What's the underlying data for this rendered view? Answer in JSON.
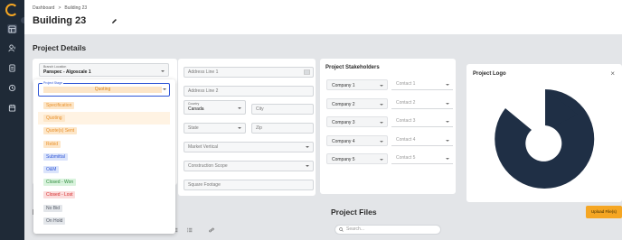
{
  "breadcrumb": {
    "items": [
      "Dashboard",
      "Building 23"
    ],
    "separator": ">"
  },
  "page": {
    "title": "Building 23"
  },
  "sections": {
    "project_details": "Project Details",
    "project_files": "Project Files",
    "lower_left_partial": "Pr"
  },
  "branch": {
    "label": "Branch Location",
    "value": "Panspec - Algoscale 1"
  },
  "stage": {
    "label": "Project Stage",
    "value": "Quoting",
    "options": [
      {
        "label": "Specification",
        "bg": "#fde6c8",
        "fg": "#e8902a",
        "selected": false
      },
      {
        "label": "Quoting",
        "bg": "#fde6c8",
        "fg": "#e8902a",
        "selected": true
      },
      {
        "label": "Quote(s) Sent",
        "bg": "#fde6c8",
        "fg": "#e8902a",
        "selected": false
      },
      {
        "label": "Rebid",
        "bg": "#fde6c8",
        "fg": "#e8902a",
        "selected": false
      },
      {
        "label": "Submittal",
        "bg": "#dbe4fb",
        "fg": "#2f56d6",
        "selected": false
      },
      {
        "label": "O&M",
        "bg": "#dbe4fb",
        "fg": "#2f56d6",
        "selected": false
      },
      {
        "label": "Closed - Won",
        "bg": "#d9f3dd",
        "fg": "#2e8b3d",
        "selected": false
      },
      {
        "label": "Closed - Lost",
        "bg": "#fbdcdc",
        "fg": "#d62b2b",
        "selected": false
      },
      {
        "label": "No Bid",
        "bg": "#e3e6ea",
        "fg": "#555b66",
        "selected": false
      },
      {
        "label": "On Hold",
        "bg": "#e3e6ea",
        "fg": "#555b66",
        "selected": false
      }
    ]
  },
  "address": {
    "line1_placeholder": "Address Line 1",
    "line2_placeholder": "Address Line 2",
    "country_label": "Country",
    "country_value": "Canada",
    "city_placeholder": "City",
    "state_placeholder": "State",
    "zip_placeholder": "Zip",
    "market_vertical_placeholder": "Market Vertical",
    "construction_scope_placeholder": "Construction Scope",
    "square_footage_placeholder": "Square Footage"
  },
  "stakeholders": {
    "title": "Project Stakeholders",
    "companies": [
      "Company 1",
      "Company 2",
      "Company 3",
      "Company 4",
      "Company 5"
    ],
    "contacts": [
      "Contact 1",
      "Contact 2",
      "Contact 3",
      "Contact 4",
      "Contact 5"
    ]
  },
  "logo": {
    "title": "Project Logo",
    "close": "×"
  },
  "files": {
    "upload_label": "Upload File(s)",
    "search_placeholder": "Search..."
  },
  "colors": {
    "sidebar": "#1f2a37",
    "accent": "#f5a623",
    "primary": "#2f56d6",
    "logo_shape": "#1f2f45"
  }
}
